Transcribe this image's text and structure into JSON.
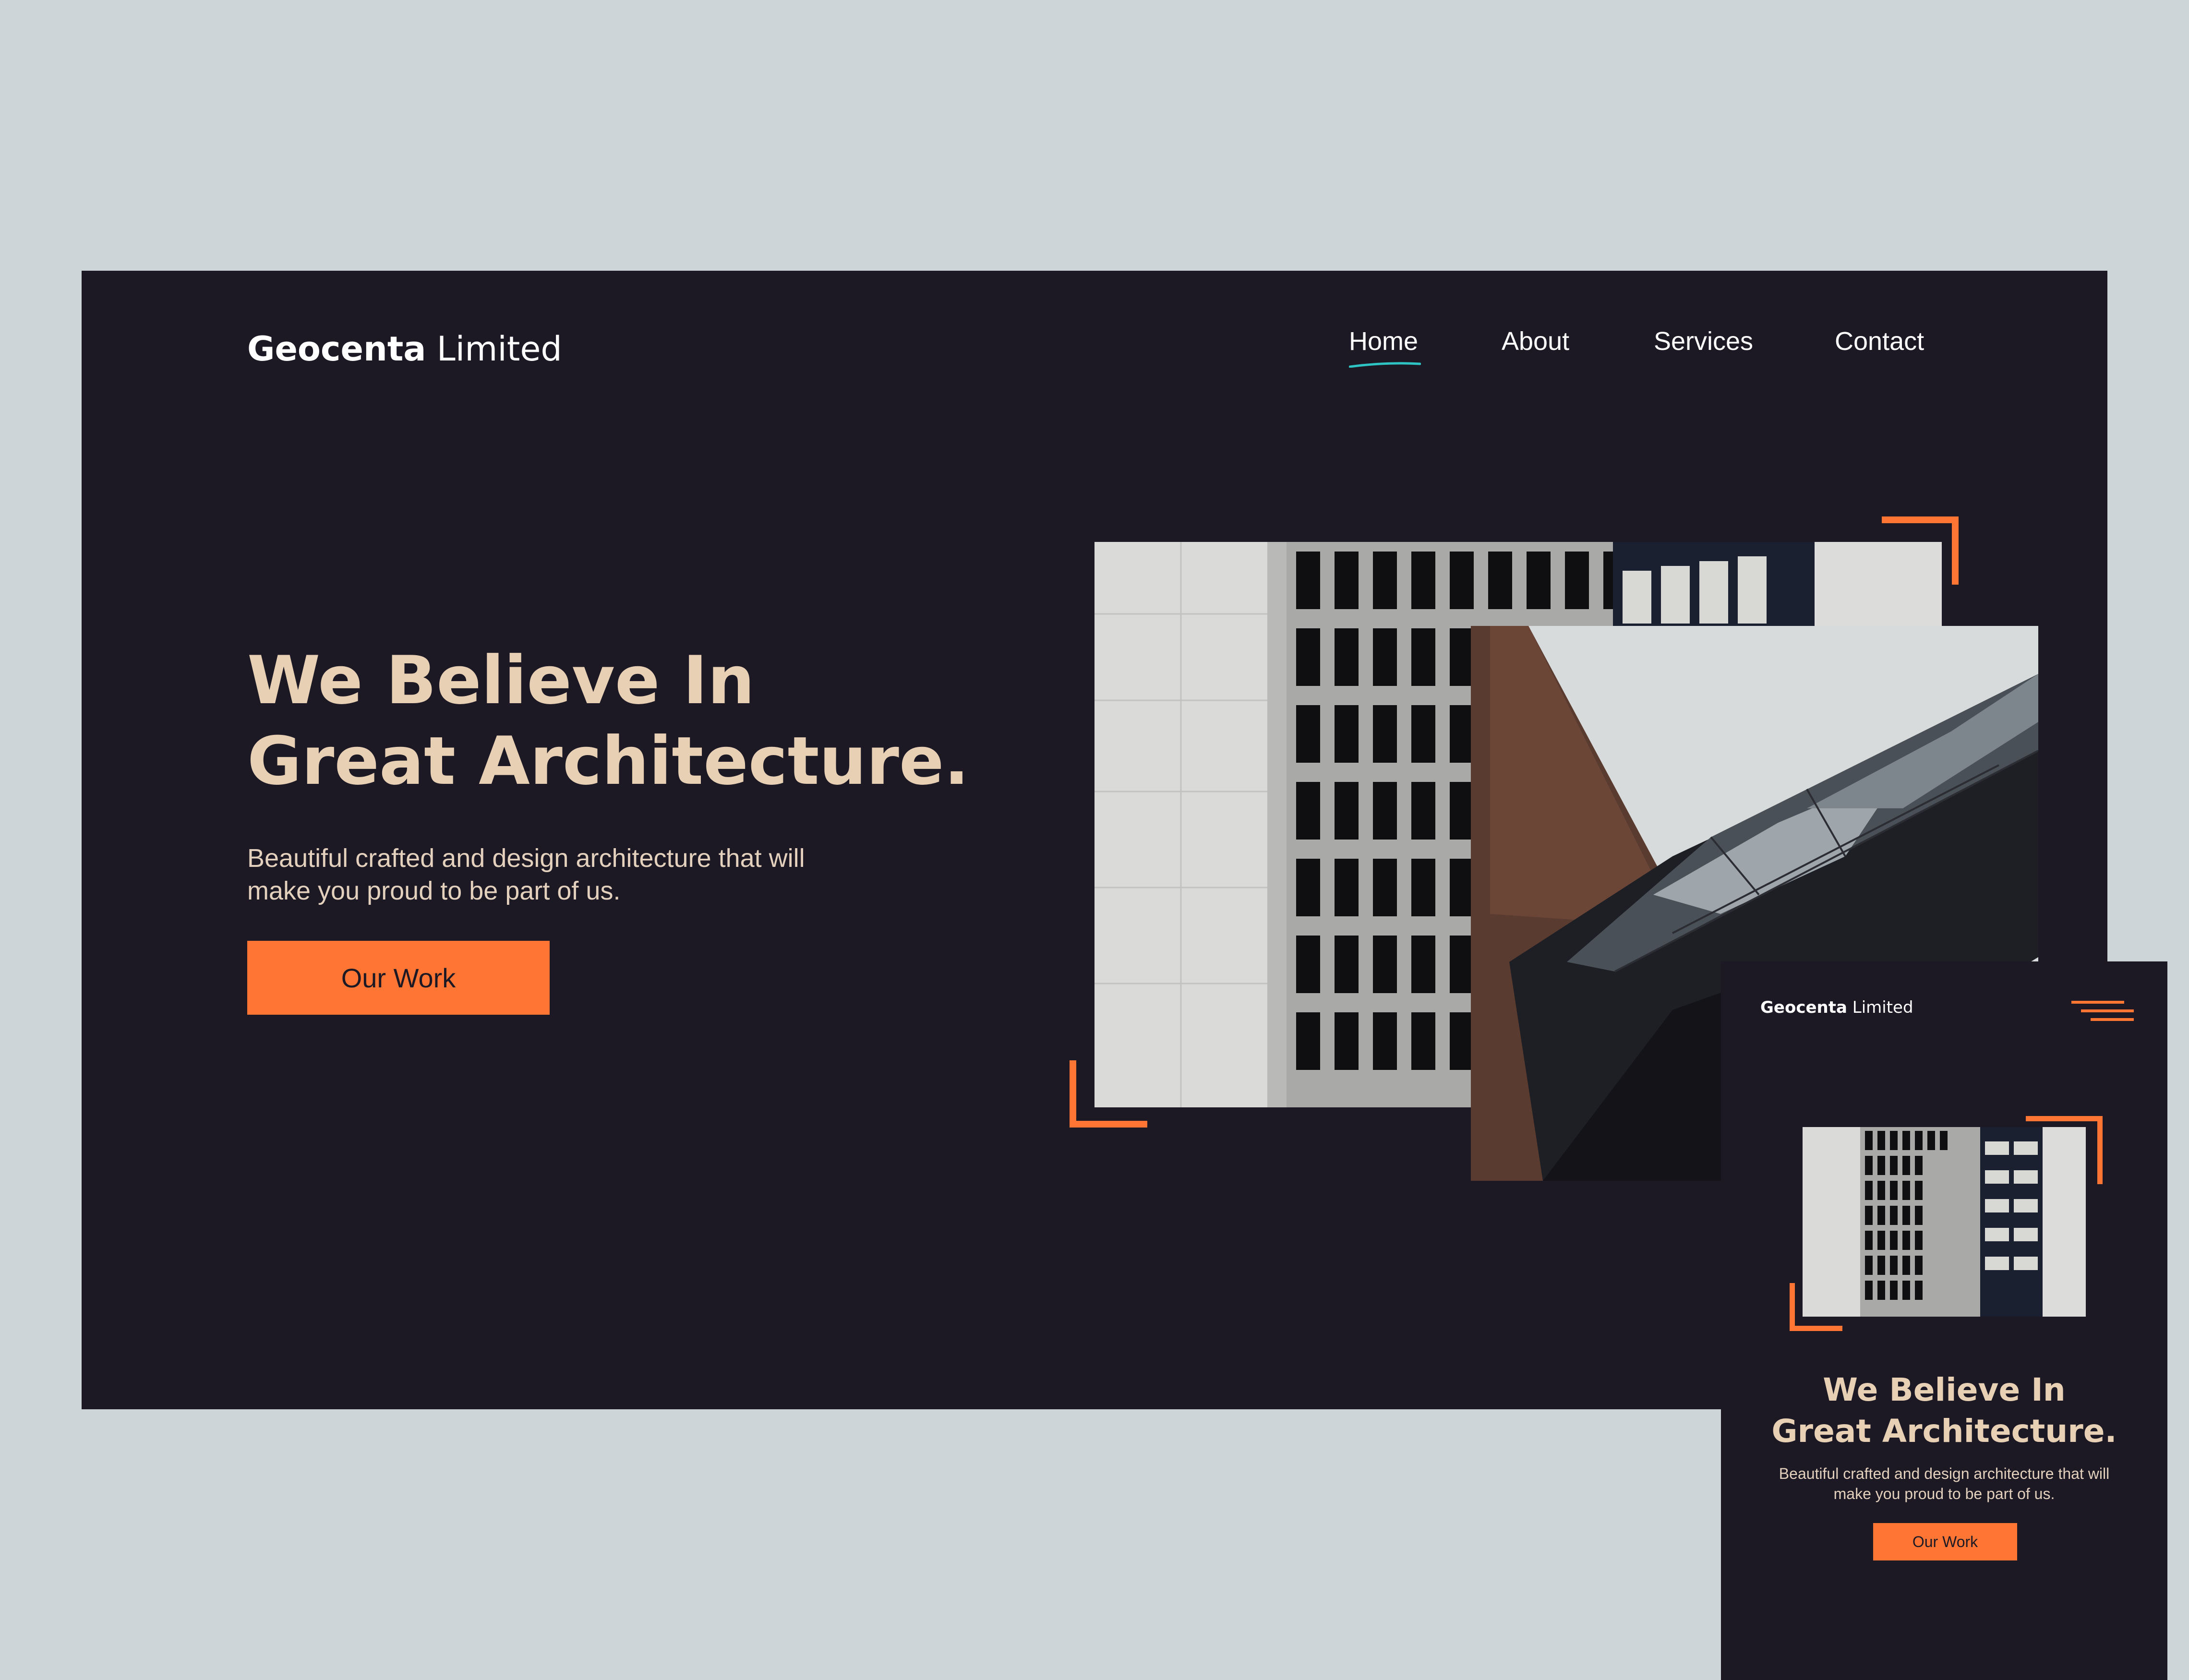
{
  "colors": {
    "background": "#cdd5d8",
    "frame": "#1c1925",
    "accent": "#ff7533",
    "heading": "#e8d0b5",
    "nav_underline": "#2ec4c4"
  },
  "desktop": {
    "brand": {
      "bold": "Geocenta",
      "light": "Limited"
    },
    "nav": [
      {
        "label": "Home",
        "active": true
      },
      {
        "label": "About"
      },
      {
        "label": "Services"
      },
      {
        "label": "Contact"
      }
    ],
    "hero": {
      "title_line1": "We Believe In",
      "title_line2": "Great Architecture.",
      "subtitle_line1": "Beautiful crafted and design architecture that will",
      "subtitle_line2": "make you proud to be part of us.",
      "cta_label": "Our Work"
    },
    "images": [
      "concrete-facade-photo",
      "angular-glass-building-photo"
    ]
  },
  "mobile": {
    "brand": {
      "bold": "Geocenta",
      "light": "Limited"
    },
    "menu_icon": "hamburger-icon",
    "hero": {
      "title_line1": "We Believe In",
      "title_line2": "Great Architecture.",
      "subtitle_line1": "Beautiful crafted and design architecture that will",
      "subtitle_line2": "make you proud to be part of us.",
      "cta_label": "Our Work"
    },
    "images": [
      "concrete-facade-photo"
    ]
  }
}
